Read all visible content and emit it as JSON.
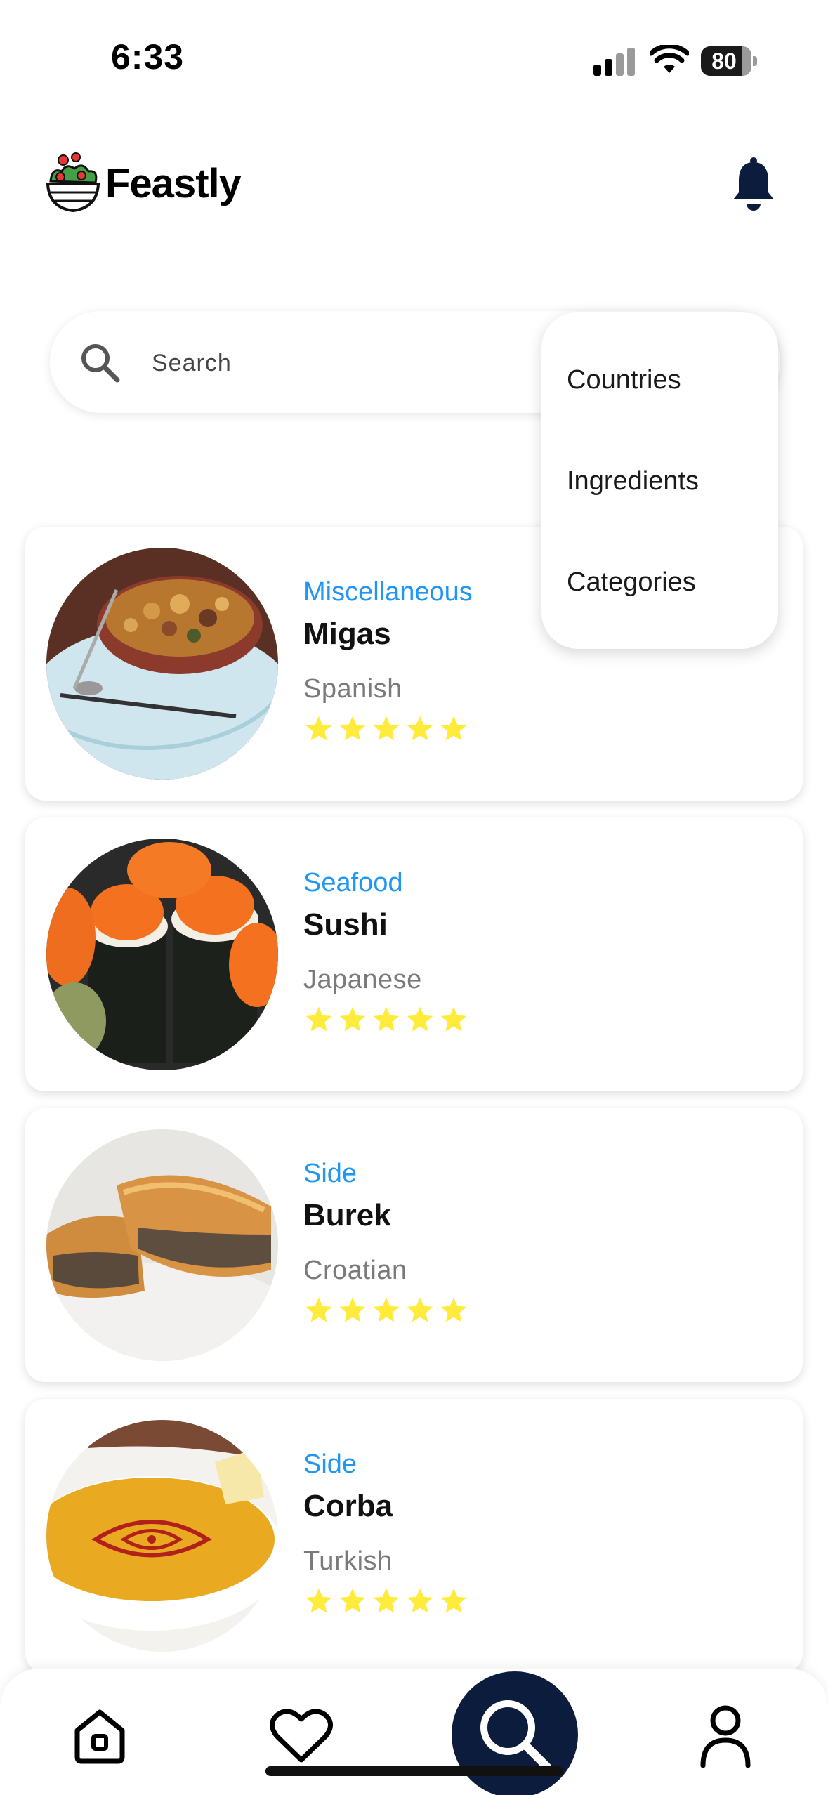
{
  "status_bar": {
    "time": "6:33",
    "battery": "80",
    "icons": [
      "signal-icon",
      "wifi-icon",
      "battery-icon"
    ]
  },
  "header": {
    "app_name": "Feastly",
    "logo_icon": "salad-bowl-icon",
    "notifications_icon": "bell-icon"
  },
  "search": {
    "placeholder": "Search",
    "icon": "search-icon"
  },
  "filter_menu": {
    "items": [
      "Countries",
      "Ingredients",
      "Categories"
    ]
  },
  "meals": [
    {
      "category": "Miscellaneous",
      "name": "Migas",
      "area": "Spanish",
      "rating": 5
    },
    {
      "category": "Seafood",
      "name": "Sushi",
      "area": "Japanese",
      "rating": 5
    },
    {
      "category": "Side",
      "name": "Burek",
      "area": "Croatian",
      "rating": 5
    },
    {
      "category": "Side",
      "name": "Corba",
      "area": "Turkish",
      "rating": 5
    }
  ],
  "bottom_nav": {
    "items": [
      {
        "icon": "home-icon",
        "active": false
      },
      {
        "icon": "heart-icon",
        "active": false
      },
      {
        "icon": "search-icon",
        "active": true
      },
      {
        "icon": "profile-icon",
        "active": false
      }
    ]
  },
  "colors": {
    "accent": "#2196f3",
    "nav_active": "#0c1c3c",
    "star": "#ffeb3b",
    "bell": "#0c1c3c"
  }
}
